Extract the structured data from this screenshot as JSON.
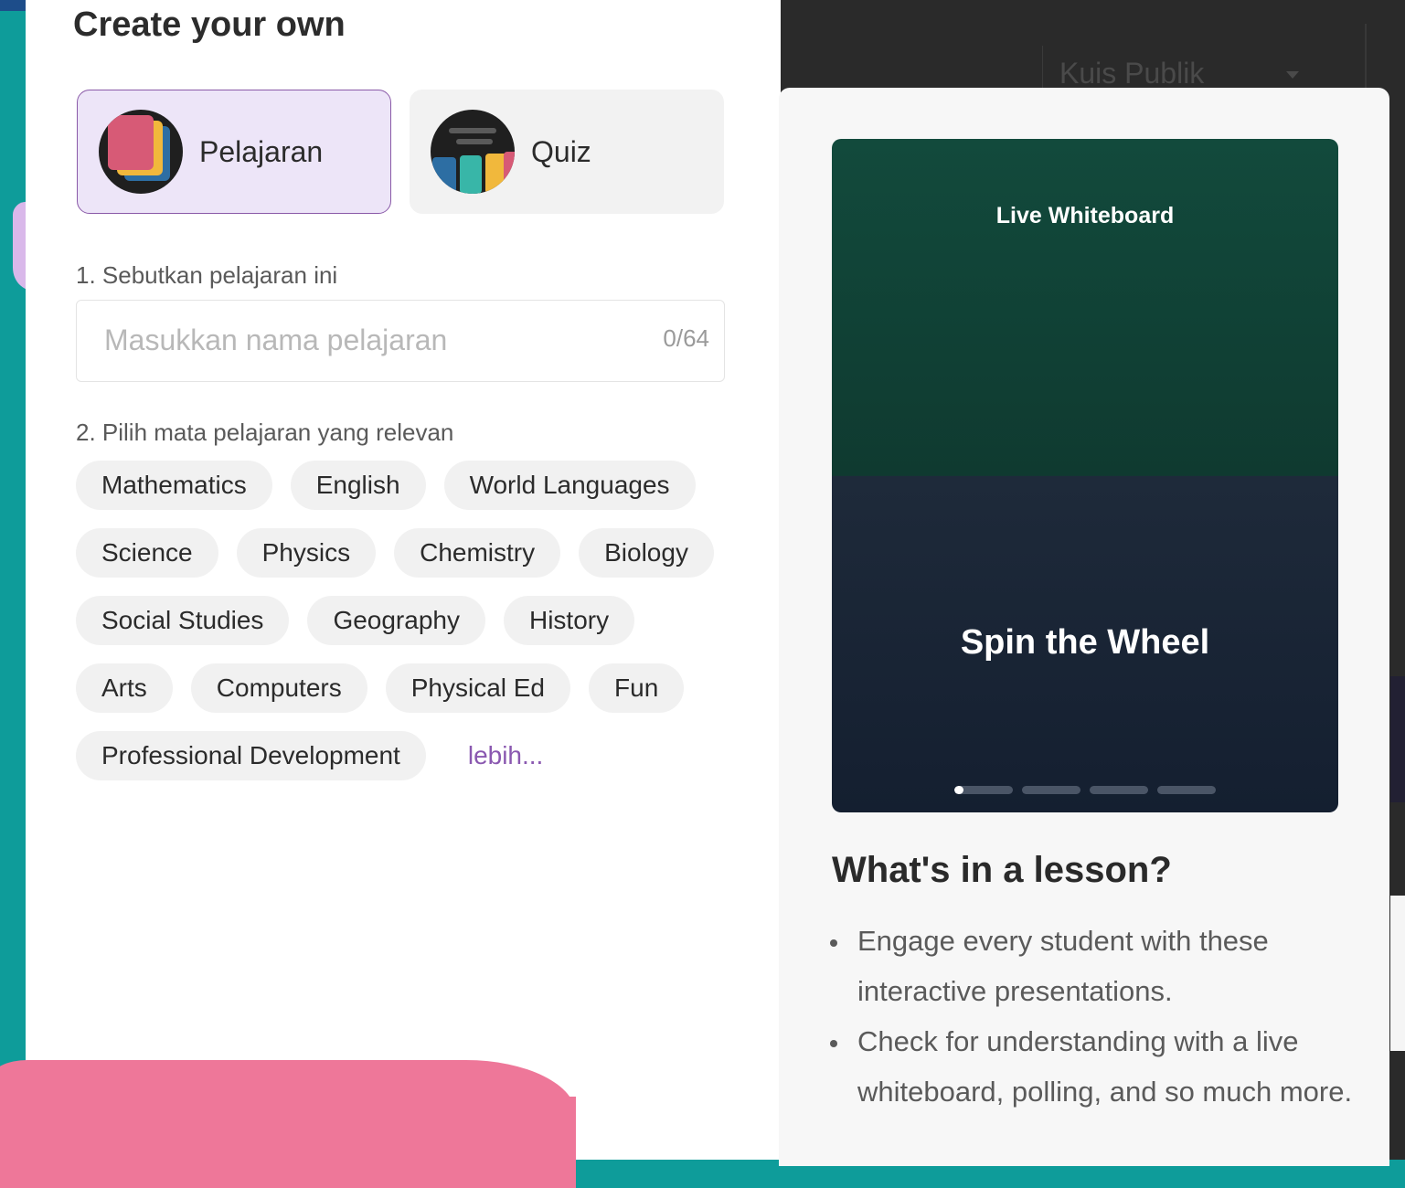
{
  "page_title": "Create your own",
  "types": [
    {
      "label": "Pelajaran",
      "selected": true
    },
    {
      "label": "Quiz",
      "selected": false
    }
  ],
  "name_section": {
    "label": "1. Sebutkan pelajaran ini",
    "placeholder": "Masukkan nama pelajaran",
    "value": "",
    "counter": "0/64"
  },
  "subjects_section": {
    "label": "2. Pilih mata pelajaran yang relevan",
    "rows": [
      [
        "Mathematics",
        "English",
        "World Languages"
      ],
      [
        "Science",
        "Physics",
        "Chemistry",
        "Biology"
      ],
      [
        "Social Studies",
        "Geography",
        "History"
      ],
      [
        "Arts",
        "Computers",
        "Physical Ed",
        "Fun"
      ],
      [
        "Professional Development"
      ]
    ],
    "more_label": "lebih..."
  },
  "background": {
    "select_label": "Kuis Publik"
  },
  "preview": {
    "caption_top": "Live Whiteboard",
    "caption_main": "Spin the Wheel",
    "slide_count": 4,
    "active_slide": 1,
    "active_progress": 0.15
  },
  "info": {
    "heading": "What's in a lesson?",
    "bullets": [
      "Engage every student with these interactive presentations.",
      "Check for understanding with a live whiteboard, polling, and so much more."
    ]
  },
  "colors": {
    "accent": "#8a58b0",
    "selected_bg": "#ede5f8",
    "background_teal": "#0e9c9a",
    "pink_blob": "#ee7799"
  }
}
